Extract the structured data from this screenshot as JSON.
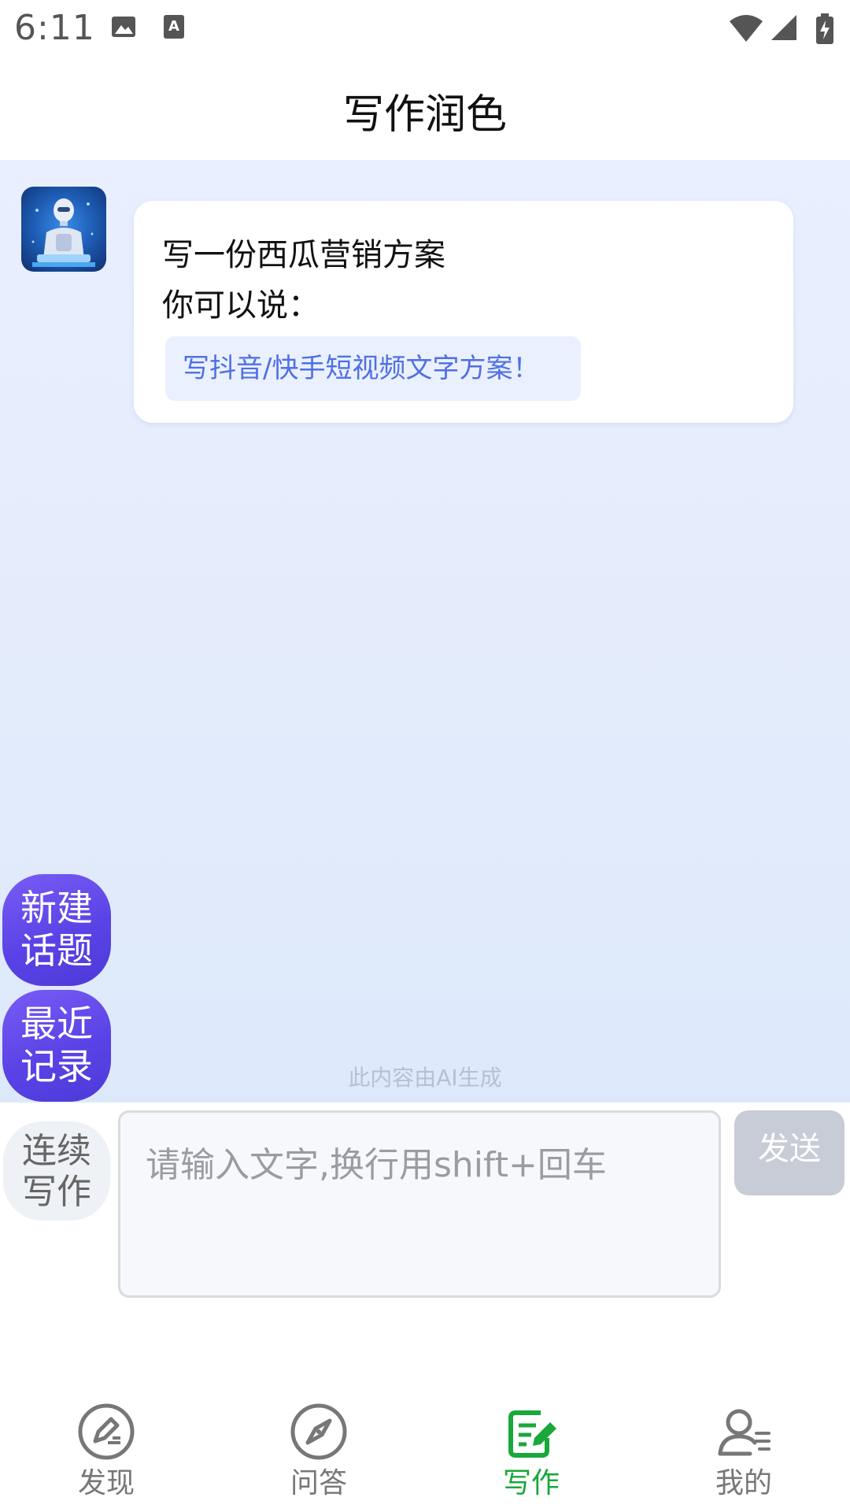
{
  "status_bar": {
    "time": "6:11",
    "icons": [
      "image-icon",
      "text-a-icon",
      "wifi-icon",
      "signal-icon",
      "battery-charging-icon"
    ]
  },
  "header": {
    "title": "写作润色"
  },
  "chat": {
    "message": {
      "title": "写一份西瓜营销方案",
      "subtitle": "你可以说：",
      "suggestion": "写抖音/快手短视频文字方案！"
    },
    "ai_notice": "此内容由AI生成"
  },
  "side_buttons": {
    "new_topic": "新建\n话题",
    "recent": "最近\n记录"
  },
  "composer": {
    "mode_label": "连续\n写作",
    "placeholder": "请输入文字,换行用shift+回车",
    "send_label": "发送"
  },
  "tabs": [
    {
      "label": "发现",
      "icon": "edit-circle-icon",
      "active": false
    },
    {
      "label": "问答",
      "icon": "compass-icon",
      "active": false
    },
    {
      "label": "写作",
      "icon": "write-note-icon",
      "active": true
    },
    {
      "label": "我的",
      "icon": "user-profile-icon",
      "active": false
    }
  ],
  "colors": {
    "accent_green": "#19a83a",
    "purple_button": "#5a43e6",
    "suggestion_text": "#4f6fe6"
  }
}
